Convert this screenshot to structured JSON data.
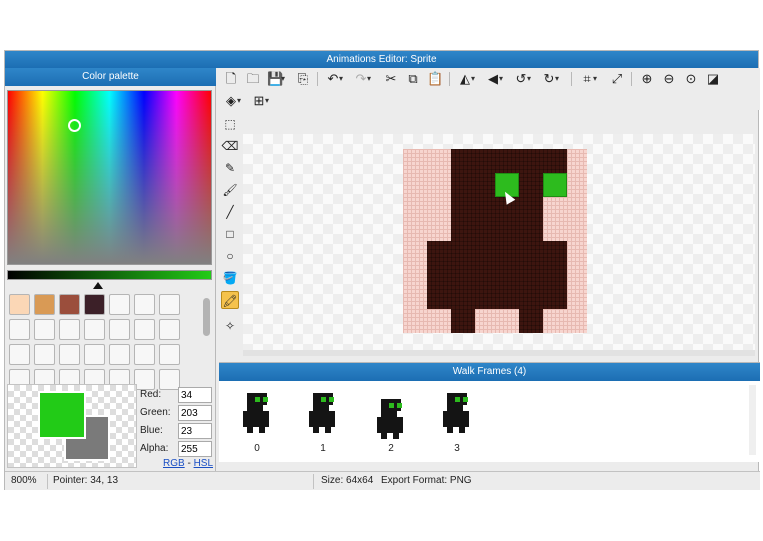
{
  "window": {
    "title": "Animations Editor: Sprite"
  },
  "palette": {
    "title": "Color palette",
    "swatches": [
      "#fbd7b6",
      "#d99a55",
      "#9b4e3c",
      "#3c2028",
      "",
      "",
      "",
      "",
      "",
      "",
      "",
      "",
      "",
      "",
      "",
      "",
      "",
      "",
      "",
      "",
      "",
      "",
      "",
      "",
      "",
      "",
      "",
      ""
    ],
    "primary_color": "#22cb17",
    "secondary_color": "#7a7a7a",
    "labels": {
      "red": "Red:",
      "green": "Green:",
      "blue": "Blue:",
      "alpha": "Alpha:"
    },
    "values": {
      "red": "34",
      "green": "203",
      "blue": "23",
      "alpha": "255"
    },
    "mode_links": {
      "rgb": "RGB",
      "sep": " - ",
      "hsl": "HSL"
    }
  },
  "toolbar": {
    "icons": [
      "new-file-icon",
      "open-folder-icon",
      "save-icon",
      "export-icon",
      "undo-icon",
      "redo-icon",
      "cut-icon",
      "copy-icon",
      "paste-icon",
      "flip-horizontal-icon",
      "flip-vertical-icon",
      "rotate-left-icon",
      "rotate-right-icon",
      "crop-icon",
      "resize-icon",
      "zoom-in-icon",
      "zoom-out-icon",
      "zoom-reset-icon",
      "invert-icon",
      "layers-icon",
      "grid-icon"
    ]
  },
  "tools": [
    "select-tool-icon",
    "eraser-tool-icon",
    "pencil-tool-icon",
    "brush-tool-icon",
    "line-tool-icon",
    "rectangle-tool-icon",
    "ellipse-tool-icon",
    "fill-bucket-tool-icon",
    "eyedropper-tool-icon",
    "magic-wand-tool-icon"
  ],
  "active_tool": "eyedropper-tool-icon",
  "frames": {
    "title": "Walk Frames (4)",
    "items": [
      {
        "label": "0"
      },
      {
        "label": "1"
      },
      {
        "label": "2"
      },
      {
        "label": "3"
      }
    ]
  },
  "status": {
    "zoom": "800%",
    "pointer": "Pointer: 34, 13",
    "size": "Size: 64x64",
    "export_format": "Export Format: PNG"
  }
}
